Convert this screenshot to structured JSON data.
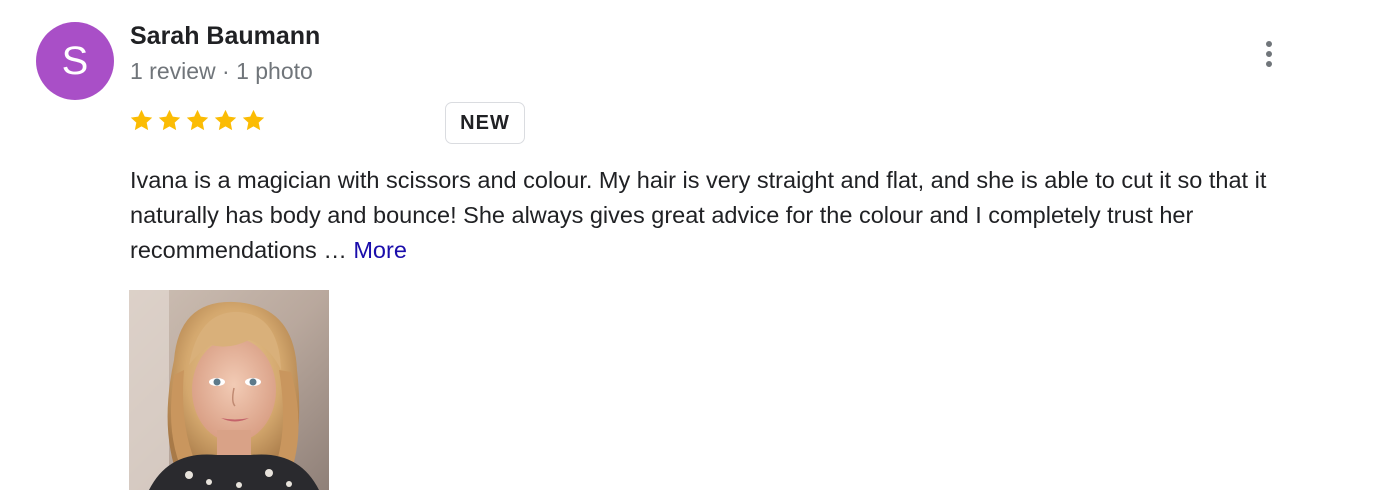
{
  "reviewer": {
    "initial": "S",
    "name": "Sarah Baumann",
    "meta": "1 review · 1 photo",
    "avatar_color": "#a94fc7"
  },
  "menu": {
    "icon": "more-vert-icon"
  },
  "rating": {
    "value": 5,
    "max": 5,
    "star_color": "#fbbc04",
    "icon": "star-icon"
  },
  "badge": {
    "label": "NEW"
  },
  "review": {
    "text": "Ivana is a magician with scissors and colour. My hair is very straight and flat, and she is able to cut it so that it naturally has body and bounce! She always gives great advice for the colour and I completely trust her recommendations …",
    "more_label": "More",
    "link_color": "#1a0dab"
  }
}
